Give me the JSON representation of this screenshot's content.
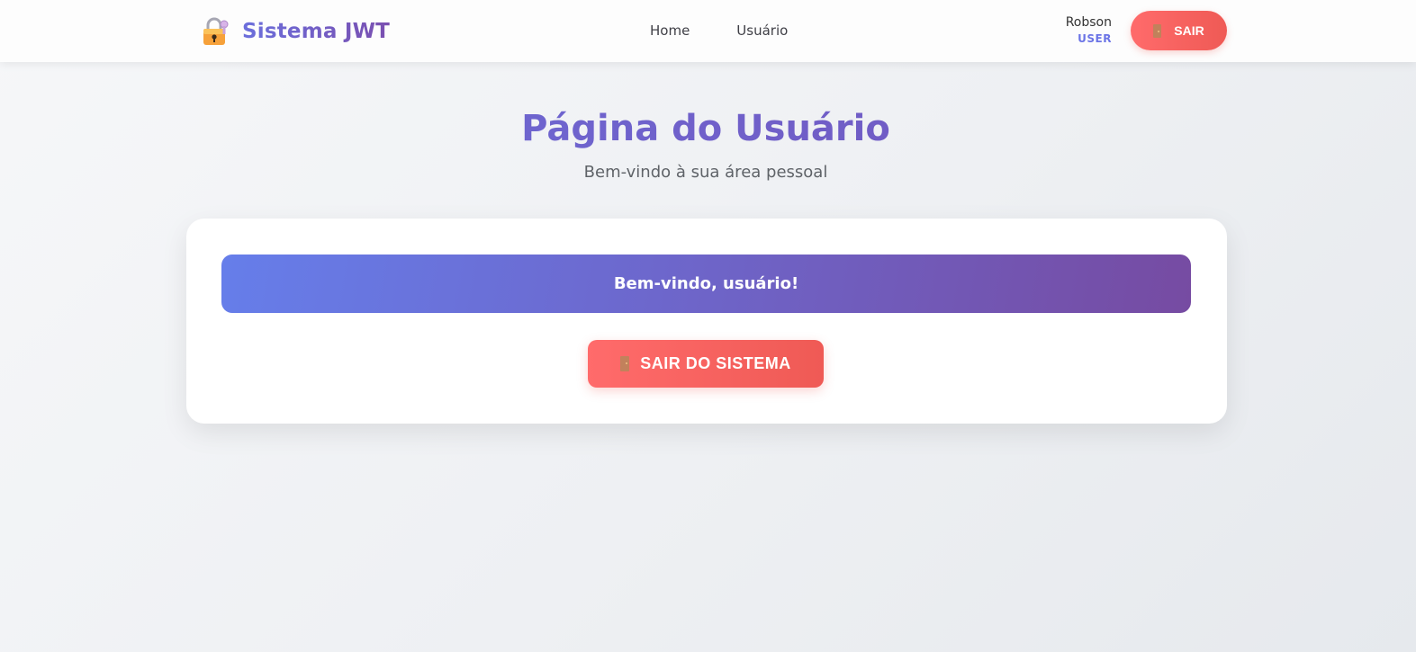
{
  "navbar": {
    "brand": {
      "icon": "lock-with-key-icon",
      "name": "Sistema JWT"
    },
    "links": [
      {
        "label": "Home"
      },
      {
        "label": "Usuário"
      }
    ],
    "user": {
      "name": "Robson",
      "role": "USER"
    },
    "logout_label": "SAIR",
    "logout_icon": "door-icon"
  },
  "main": {
    "title": "Página do Usuário",
    "subtitle": "Bem-vindo à sua área pessoal",
    "welcome_message": "Bem-vindo, usuário!",
    "logout_label": "SAIR DO SISTEMA",
    "logout_icon": "door-icon"
  },
  "colors": {
    "brand_gradient_start": "#667eea",
    "brand_gradient_end": "#764ba2",
    "logout_red": "#ff6b6b",
    "role_blue": "#6b74e6"
  }
}
